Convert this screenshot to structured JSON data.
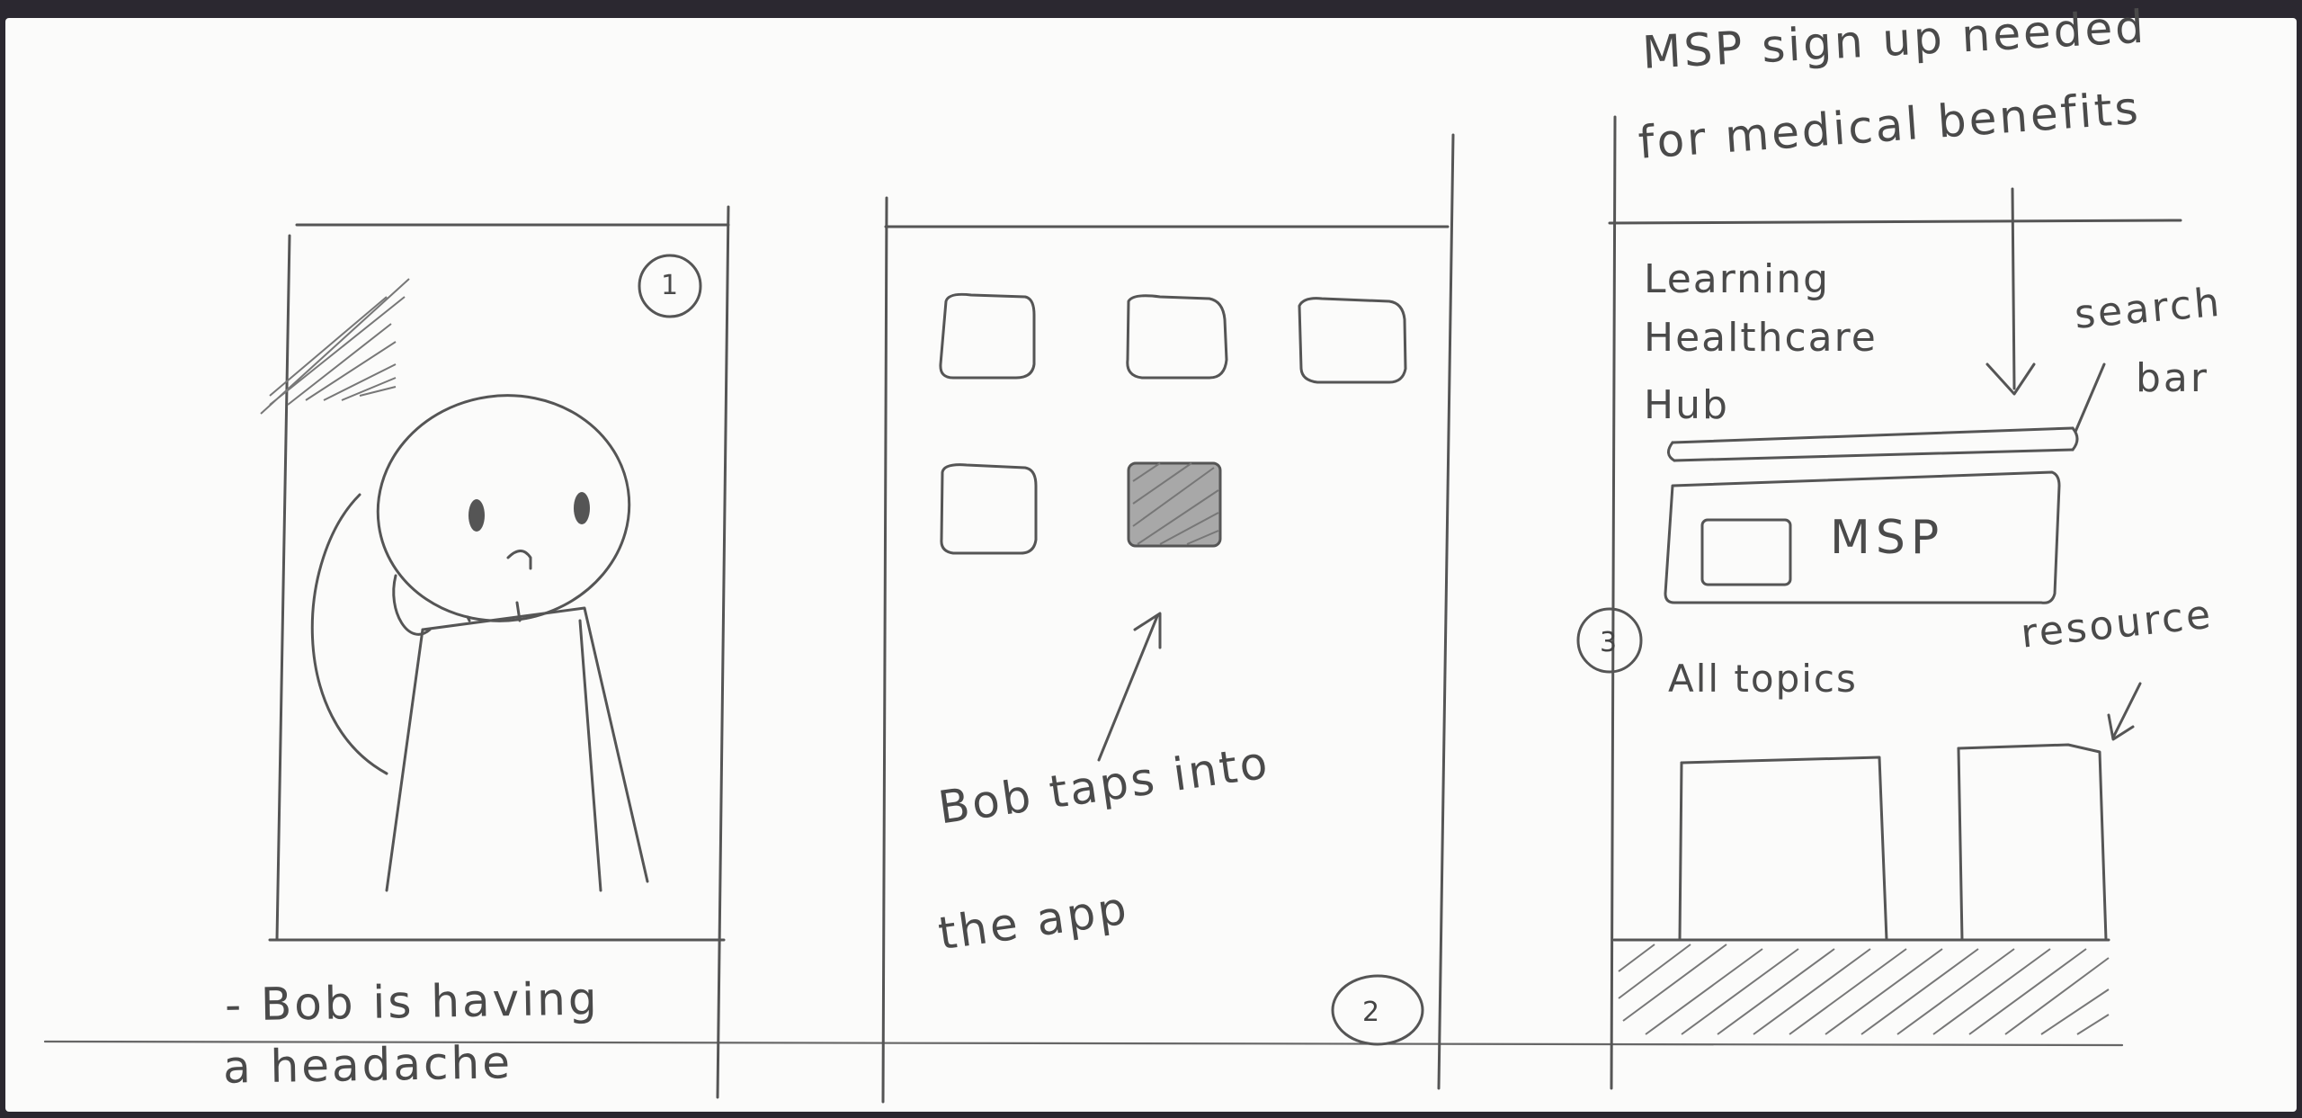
{
  "panel1": {
    "number": "1",
    "caption_line1": "- Bob is having",
    "caption_line2": "a headache"
  },
  "panel2": {
    "number": "2",
    "caption_line1": "Bob taps into",
    "caption_line2": "the app"
  },
  "panel3": {
    "number": "3",
    "header_note_line1": "MSP sign up needed",
    "header_note_line2": "for medical benefits",
    "title_line1": "Learning",
    "title_line2": "Healthcare",
    "title_line3": "Hub",
    "search_bar_label_line1": "search",
    "search_bar_label_line2": "bar",
    "msp_button_label": "MSP",
    "all_topics_label": "All topics",
    "resource_label": "resource"
  }
}
